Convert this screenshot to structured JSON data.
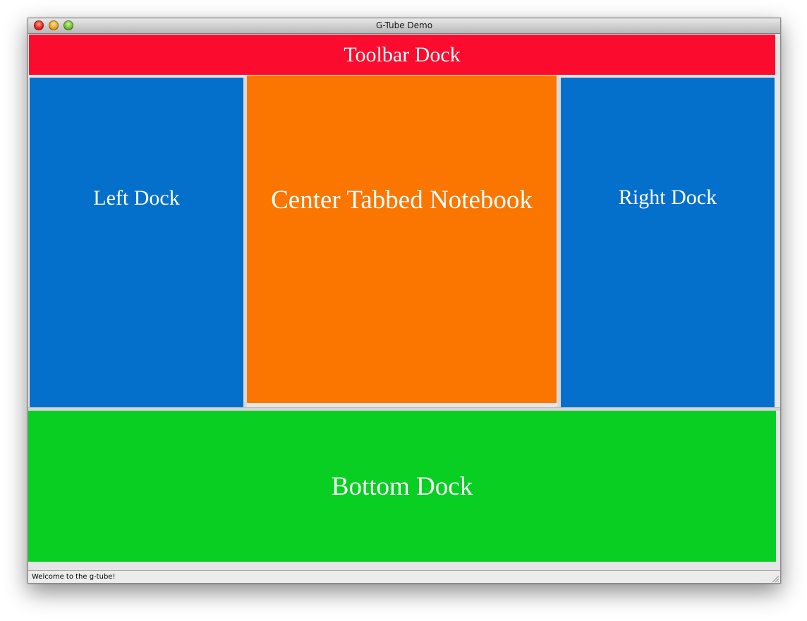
{
  "window": {
    "title": "G-Tube Demo"
  },
  "docks": {
    "toolbar": "Toolbar Dock",
    "left": "Left Dock",
    "center": "Center Tabbed Notebook",
    "right": "Right Dock",
    "bottom": "Bottom Dock"
  },
  "statusbar": {
    "message": "Welcome to the g-tube!"
  },
  "colors": {
    "toolbar": "#fb0b2e",
    "side_docks": "#0570cc",
    "center": "#fa7600",
    "bottom": "#08cf22"
  },
  "icons": {
    "close": "close-button-icon",
    "minimize": "minimize-button-icon",
    "zoom": "zoom-button-icon",
    "resize": "resize-grip-icon"
  }
}
